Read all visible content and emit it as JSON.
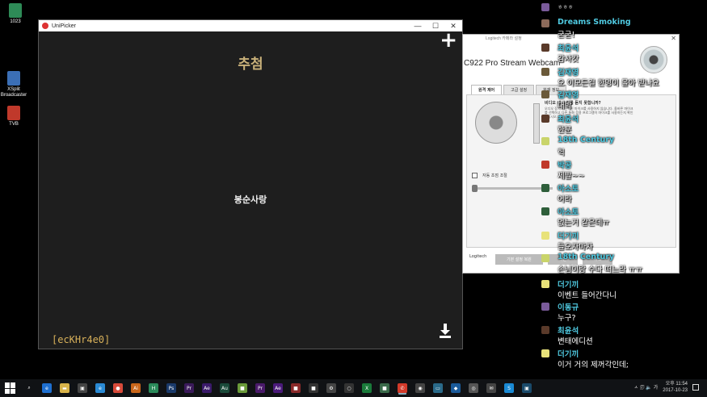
{
  "desktop": {
    "icons": [
      {
        "label": "1023",
        "color": "#2e8b57"
      },
      {
        "label": "XSplit Broadcaster",
        "color": "#3b6fb6"
      },
      {
        "label": "TVB",
        "color": "#c0392b"
      }
    ]
  },
  "unipicker": {
    "title": "UniPicker",
    "minimize": "—",
    "maximize": "☐",
    "close": "✕",
    "plus": "+",
    "heading": "추첨",
    "result": "봉순사랑",
    "code": "[ecKHr4e0]"
  },
  "logitech": {
    "title": "Logitech 카메라 설정",
    "close": "✕",
    "model": "C922 Pro Stream Webcam",
    "tabs": [
      "원격 제어",
      "고급 설정",
      "화재 정보"
    ],
    "question": "비디오 내 소리를 듣지 못합니까?",
    "help_text": "오디오 장치가 선택된 마이크를 사용하지 않습니다. 올바른 마이크를 선택하고 다른 통화 응용 프로그램이 마이크를 사용하는지 확인하십시오.",
    "auto_focus": "자동 초점 조절",
    "buttons": [
      "기본 설정 복원",
      "확인",
      "취소"
    ],
    "logo": "Logitech"
  },
  "chat": [
    {
      "name": "",
      "text": "ㅎㅎㅎ",
      "avatar": "#7a5b9a"
    },
    {
      "name": "Dreams Smoking",
      "text": "굳굳!",
      "avatar": "#8c6a5a"
    },
    {
      "name": "최윤석",
      "text": "감사캇",
      "avatar": "#5a3a2a"
    },
    {
      "name": "김재영",
      "text": "오 이모든걸 한명이 몰아 받나요",
      "avatar": "#6b5a3a"
    },
    {
      "name": "김재영",
      "text": "대박",
      "avatar": "#6b5a3a"
    },
    {
      "name": "최윤석",
      "text": "한분",
      "avatar": "#5a3a2a"
    },
    {
      "name": "18th Century",
      "text": "헉",
      "avatar": "#c9d46a"
    },
    {
      "name": "박공",
      "text": "제발~~",
      "avatar": "#c0392b"
    },
    {
      "name": "아소토",
      "text": "어라",
      "avatar": "#2e5e3a"
    },
    {
      "name": "아소토",
      "text": "없는거 같은데ㅠ",
      "avatar": "#2e5e3a"
    },
    {
      "name": "더기끼",
      "text": "들오자마자",
      "avatar": "#e8e27a"
    },
    {
      "name": "18th Century",
      "text": "손님이랑 수다 떠느라 ㅠㅠ",
      "avatar": "#c9d46a"
    },
    {
      "name": "더기끼",
      "text": "이벤트 들어간다니",
      "avatar": "#e8e27a"
    },
    {
      "name": "이동규",
      "text": "누구?",
      "avatar": "#7a5b9a"
    },
    {
      "name": "최윤석",
      "text": "변태에디션",
      "avatar": "#5a3a2a"
    },
    {
      "name": "더기끼",
      "text": "이거 거의 제꺼각인데;",
      "avatar": "#e8e27a"
    }
  ],
  "taskbar": {
    "apps": [
      {
        "name": "search-icon",
        "glyph": "⌕",
        "color": "#101215"
      },
      {
        "name": "edge-icon",
        "glyph": "e",
        "color": "#1e6fd0"
      },
      {
        "name": "folder-icon",
        "glyph": "▬",
        "color": "#d9b44a"
      },
      {
        "name": "store-icon",
        "glyph": "▣",
        "color": "#444"
      },
      {
        "name": "ie-icon",
        "glyph": "e",
        "color": "#2a8ad4"
      },
      {
        "name": "chrome-icon",
        "glyph": "●",
        "color": "#d84a3a"
      },
      {
        "name": "illustrator-icon",
        "glyph": "Ai",
        "color": "#c9661a"
      },
      {
        "name": "app-h-icon",
        "glyph": "H",
        "color": "#2a8a5a"
      },
      {
        "name": "photoshop-icon",
        "glyph": "Ps",
        "color": "#1a3a6a"
      },
      {
        "name": "premiere-icon",
        "glyph": "Pr",
        "color": "#3a1a5a"
      },
      {
        "name": "aftereffects-icon",
        "glyph": "Ae",
        "color": "#3a1a6a"
      },
      {
        "name": "audition-icon",
        "glyph": "Au",
        "color": "#1a4a3a"
      },
      {
        "name": "app-green-icon",
        "glyph": "■",
        "color": "#6a9a3a"
      },
      {
        "name": "premiere2-icon",
        "glyph": "Pr",
        "color": "#4a1a6a"
      },
      {
        "name": "aftereffects2-icon",
        "glyph": "Ae",
        "color": "#4a1a7a"
      },
      {
        "name": "app-red-icon",
        "glyph": "■",
        "color": "#8a2a2a"
      },
      {
        "name": "app-dark-icon",
        "glyph": "■",
        "color": "#333"
      },
      {
        "name": "settings-icon",
        "glyph": "⚙",
        "color": "#444"
      },
      {
        "name": "xsplit-icon",
        "glyph": "○",
        "color": "#333"
      },
      {
        "name": "excel-icon",
        "glyph": "X",
        "color": "#1a7a3a"
      },
      {
        "name": "app-bright-icon",
        "glyph": "■",
        "color": "#3a6a4a"
      },
      {
        "name": "phone-icon",
        "glyph": "✆",
        "color": "#d23a2a"
      },
      {
        "name": "mixer-icon",
        "glyph": "◉",
        "color": "#444"
      },
      {
        "name": "monitor-icon",
        "glyph": "▭",
        "color": "#2a6a8a"
      },
      {
        "name": "dropbox-icon",
        "glyph": "◆",
        "color": "#1a5a9a"
      },
      {
        "name": "camera-icon",
        "glyph": "◎",
        "color": "#555"
      },
      {
        "name": "chat-icon",
        "glyph": "✉",
        "color": "#444"
      },
      {
        "name": "skype-icon",
        "glyph": "S",
        "color": "#1a8ad4"
      },
      {
        "name": "terminal-icon",
        "glyph": "▣",
        "color": "#1a4a6a"
      }
    ],
    "time": "오후 11:54",
    "date": "2017-10-23",
    "tray_text": "ㅅ 🗊 🔈 가"
  }
}
